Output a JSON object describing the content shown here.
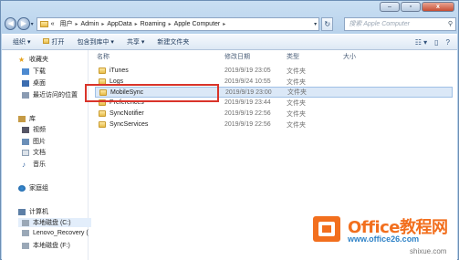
{
  "window": {
    "controls": [
      "–",
      "▫",
      "x"
    ]
  },
  "address": {
    "root_chevron": "«",
    "crumbs": [
      "用户",
      "Admin",
      "AppData",
      "Roaming",
      "Apple Computer"
    ],
    "search_placeholder": "搜索 Apple Computer"
  },
  "toolbar": {
    "items": [
      "组织 ▾",
      "打开",
      "包含到库中 ▾",
      "共享 ▾",
      "新建文件夹"
    ]
  },
  "sidebar": {
    "favorites": "收藏夹",
    "fav_items": [
      "下载",
      "桌面",
      "最近访问的位置"
    ],
    "library": "库",
    "lib_items": [
      "视频",
      "图片",
      "文档",
      "音乐"
    ],
    "homegroup": "家庭组",
    "computer": "计算机",
    "drives": [
      "本地磁盘 (C:)",
      "Lenovo_Recovery (",
      "本地磁盘 (F:)"
    ]
  },
  "columns": [
    "名称",
    "修改日期",
    "类型",
    "大小"
  ],
  "files": [
    {
      "name": "iTunes",
      "date": "2019/9/19 23:05",
      "type": "文件夹"
    },
    {
      "name": "Logs",
      "date": "2019/9/24 10:55",
      "type": "文件夹"
    },
    {
      "name": "MobileSync",
      "date": "2019/9/19 23:00",
      "type": "文件夹"
    },
    {
      "name": "Preferences",
      "date": "2019/9/19 23:44",
      "type": "文件夹"
    },
    {
      "name": "SyncNotifier",
      "date": "2019/9/19 22:56",
      "type": "文件夹"
    },
    {
      "name": "SyncServices",
      "date": "2019/9/19 22:56",
      "type": "文件夹"
    }
  ],
  "watermark": {
    "title": "Office教程网",
    "url": "www.office26.com",
    "site": "shixue.com"
  },
  "colors": {
    "highlight": "#d9342a",
    "watermark_orange": "#f26f1e",
    "watermark_blue": "#2e82c7"
  }
}
